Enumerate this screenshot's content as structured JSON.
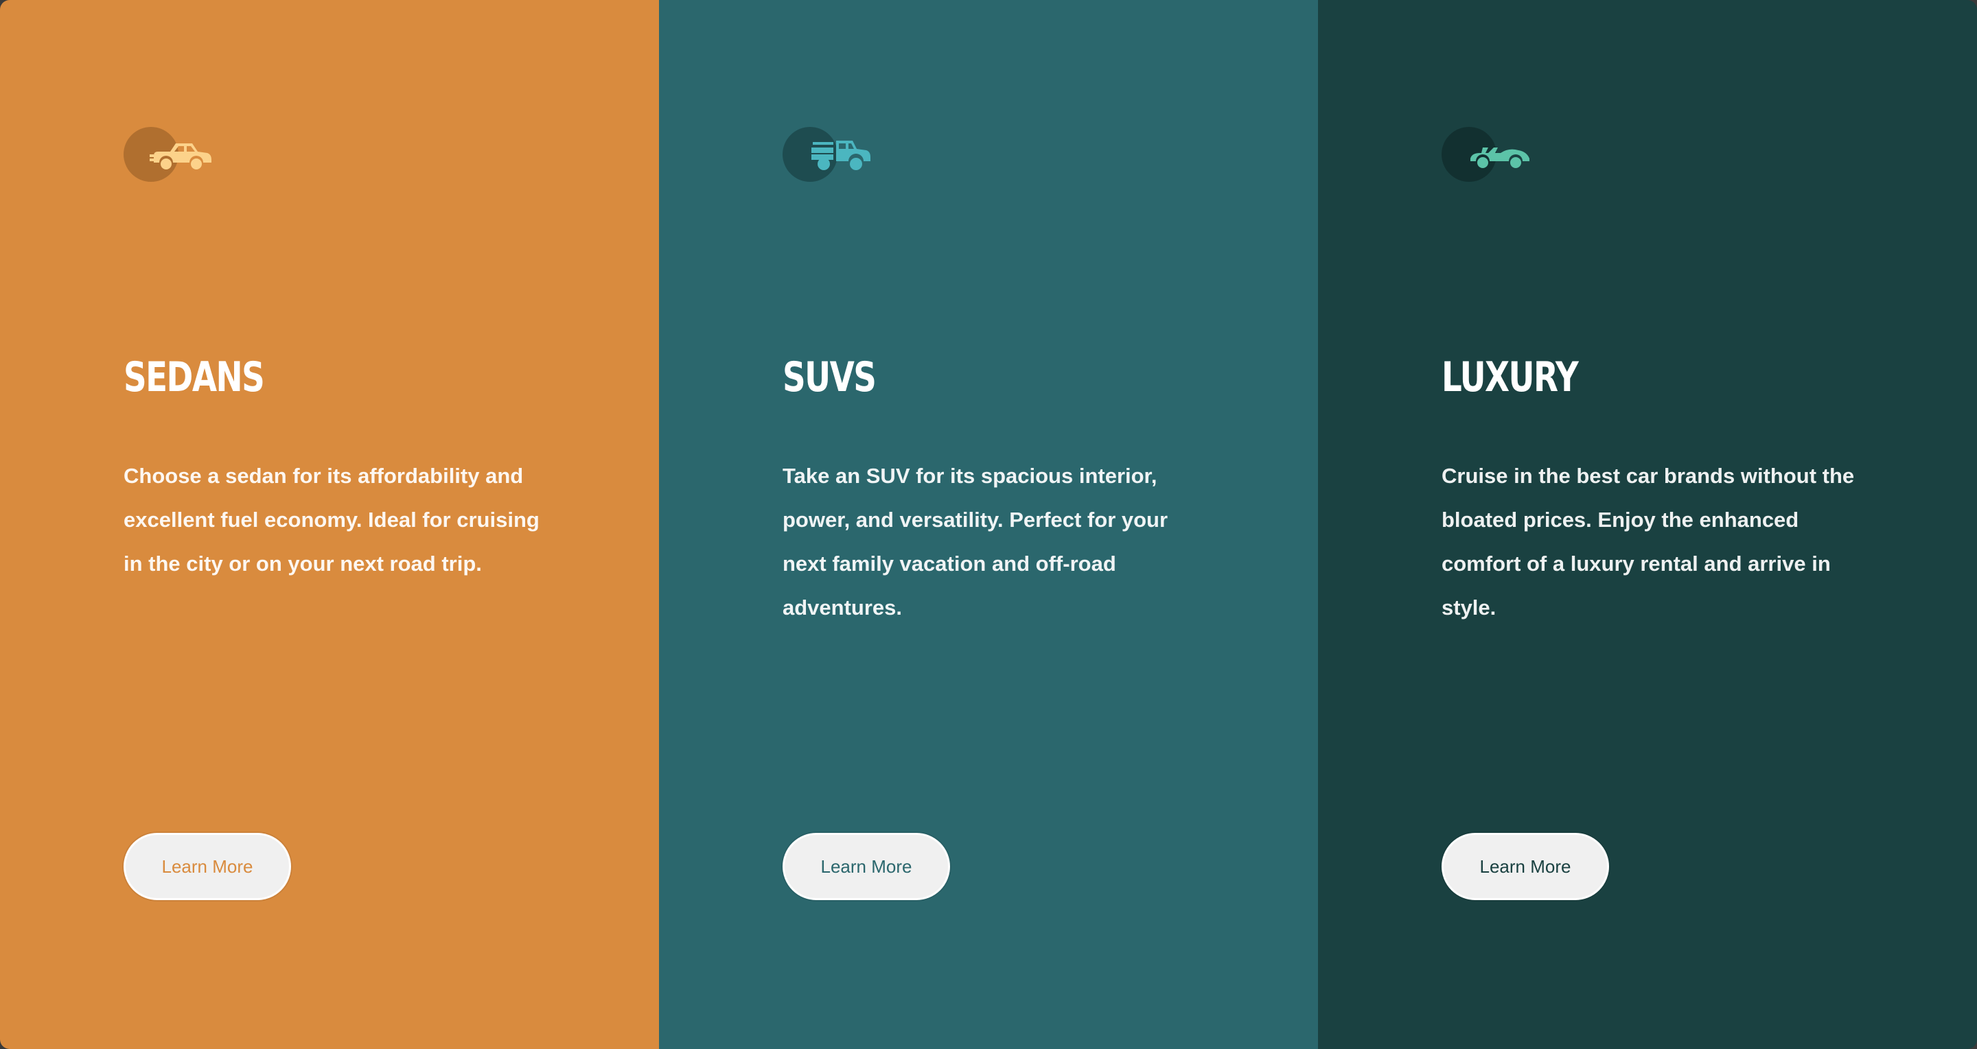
{
  "cards": [
    {
      "icon": "sedan-car-icon",
      "title": "SEDANS",
      "description": "Choose a sedan for its affordability and excellent fuel economy. Ideal for cruising in the city or on your next road trip.",
      "button_label": "Learn More",
      "colors": {
        "background": "#d98b3e",
        "icon_circle": "#b06f2f",
        "icon": "#fcd28a",
        "button_text": "#d98b3e"
      }
    },
    {
      "icon": "suv-car-icon",
      "title": "SUVS",
      "description": "Take an SUV for its spacious interior, power, and versatility. Perfect for your next family vacation and off-road adventures.",
      "button_label": "Learn More",
      "colors": {
        "background": "#2b676d",
        "icon_circle": "#1e4c50",
        "icon": "#4bb6c0",
        "button_text": "#2b676d"
      }
    },
    {
      "icon": "luxury-convertible-icon",
      "title": "LUXURY",
      "description": "Cruise in the best car brands without the bloated prices. Enjoy the enhanced comfort of a luxury rental and arrive in style.",
      "button_label": "Learn More",
      "colors": {
        "background": "#1a4141",
        "icon_circle": "#123030",
        "icon": "#5cc3a8",
        "button_text": "#1a4141"
      }
    }
  ]
}
